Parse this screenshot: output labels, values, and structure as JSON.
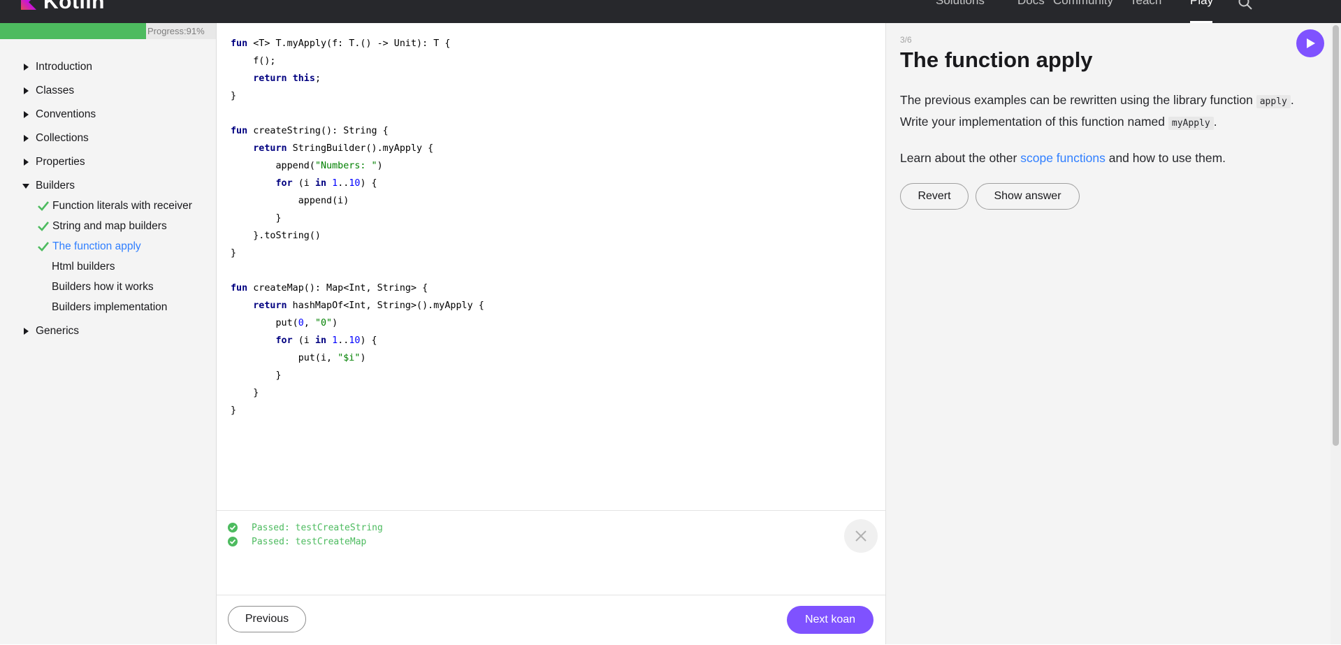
{
  "header": {
    "logo_text": "Kotlin",
    "nav": [
      "Solutions",
      "Docs",
      "Community",
      "Teach",
      "Play"
    ],
    "active_nav": "Play"
  },
  "progress": {
    "label": "Progress:91%",
    "value": 0.91
  },
  "sidebar": {
    "sections": [
      {
        "label": "Introduction",
        "expanded": false
      },
      {
        "label": "Classes",
        "expanded": false
      },
      {
        "label": "Conventions",
        "expanded": false
      },
      {
        "label": "Collections",
        "expanded": false
      },
      {
        "label": "Properties",
        "expanded": false
      },
      {
        "label": "Builders",
        "expanded": true
      },
      {
        "label": "Generics",
        "expanded": false
      }
    ],
    "builders_items": [
      {
        "label": "Function literals with receiver",
        "done": true
      },
      {
        "label": "String and map builders",
        "done": true
      },
      {
        "label": "The function apply",
        "done": true,
        "current": true
      },
      {
        "label": "Html builders",
        "done": false
      },
      {
        "label": "Builders how it works",
        "done": false
      },
      {
        "label": "Builders implementation",
        "done": false
      }
    ]
  },
  "editor": {
    "code_lines": [
      "fun <T> T.myApply(f: T.() -> Unit): T {",
      "    f();",
      "    return this;",
      "}",
      "",
      "fun createString(): String {",
      "    return StringBuilder().myApply {",
      "        append(\"Numbers: \")",
      "        for (i in 1..10) {",
      "            append(i)",
      "        }",
      "    }.toString()",
      "}",
      "",
      "fun createMap(): Map<Int, String> {",
      "    return hashMapOf<Int, String>().myApply {",
      "        put(0, \"0\")",
      "        for (i in 1..10) {",
      "            put(i, \"$i\")",
      "        }",
      "    }",
      "}"
    ]
  },
  "console": {
    "lines": [
      "Passed: testCreateString",
      "Passed: testCreateMap"
    ]
  },
  "footer": {
    "previous": "Previous",
    "next": "Next koan"
  },
  "task": {
    "counter": "3/6",
    "title": "The function apply",
    "desc_part1": "The previous examples can be rewritten using the library function",
    "code1": "apply",
    "desc_part2": ". Write your implementation of this function named",
    "code2": "myApply",
    "desc_part3": ".",
    "desc2_before": "Learn about the other",
    "desc2_link": "scope functions",
    "desc2_after": "and how to use them.",
    "revert": "Revert",
    "show_answer": "Show answer"
  },
  "colors": {
    "accent": "#7f52ff",
    "success": "#4dbb5f",
    "link": "#307fff",
    "topbar": "#27282c"
  }
}
